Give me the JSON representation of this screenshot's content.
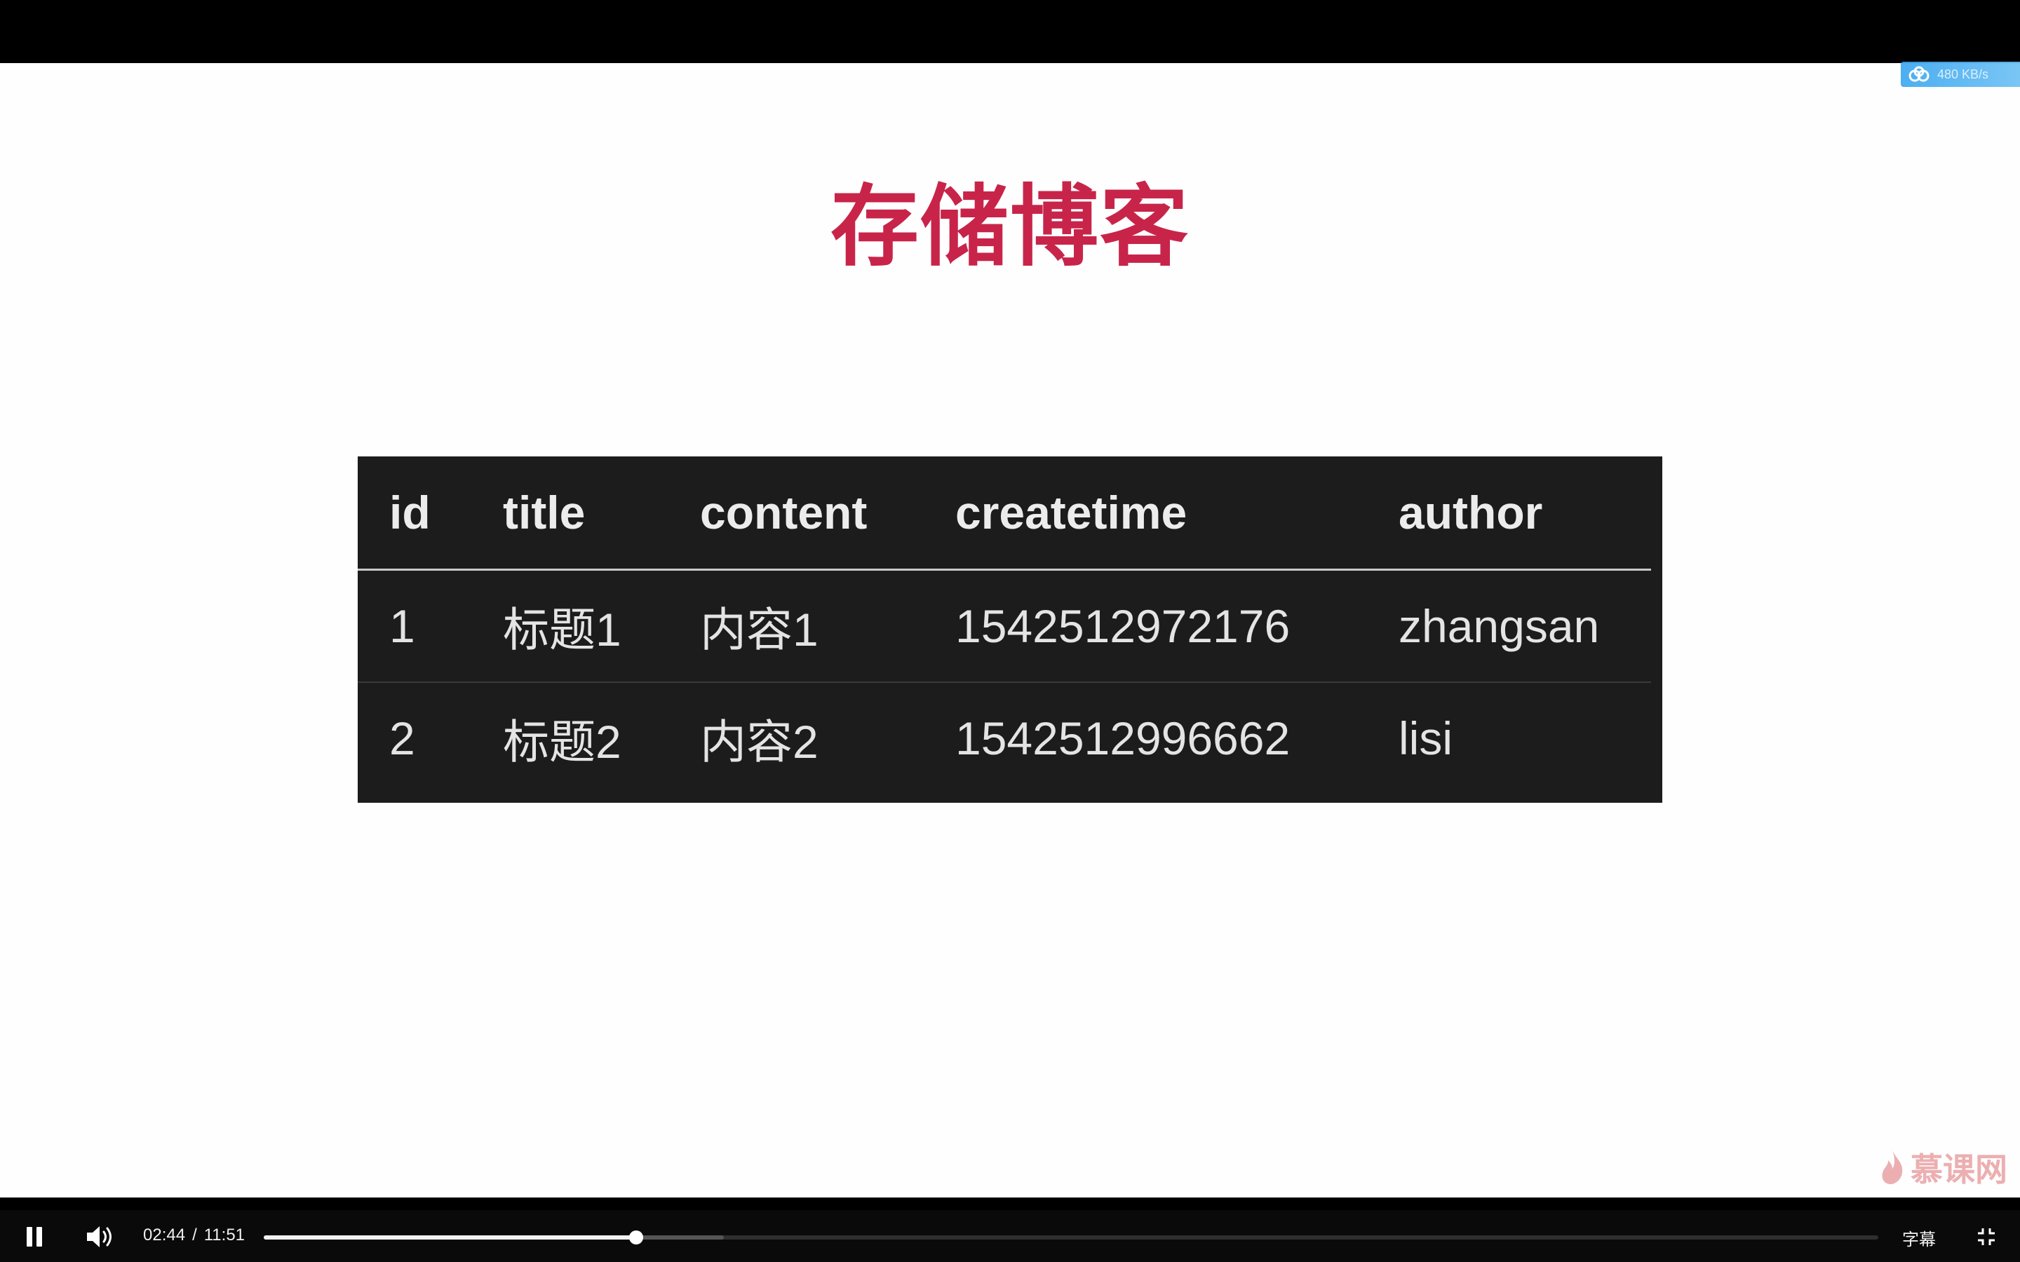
{
  "slide": {
    "title": "存储博客",
    "net_speed": "480 KB/s"
  },
  "table": {
    "headers": [
      "id",
      "title",
      "content",
      "createtime",
      "author"
    ],
    "rows": [
      [
        "1",
        "标题1",
        "内容1",
        "1542512972176",
        "zhangsan"
      ],
      [
        "2",
        "标题2",
        "内容2",
        "1542512996662",
        "lisi"
      ]
    ]
  },
  "watermark": {
    "text": "慕课网"
  },
  "player": {
    "current_time": "02:44",
    "separator": "/",
    "duration": "11:51",
    "progress_fraction": 0.2307,
    "buffered_fraction": 0.285,
    "subtitle_label": "字幕",
    "icons": [
      "pause-icon",
      "volume-icon",
      "exit-fullscreen-icon",
      "cloud-icon",
      "flame-icon"
    ]
  },
  "colors": {
    "title": "#c8244a",
    "table_bg": "#1c1c1c",
    "table_text": "#e4e4e4",
    "slide_bg": "#fefefe",
    "player_bg": "#0a0a0a",
    "badge": "#39a6f0"
  }
}
